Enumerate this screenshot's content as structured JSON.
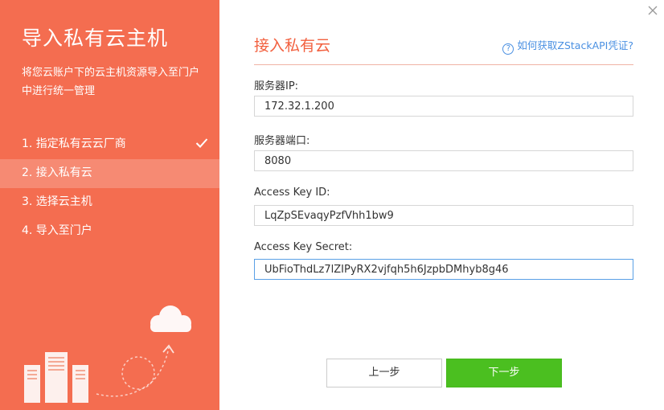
{
  "sidebar": {
    "title": "导入私有云主机",
    "description": "将您云账户下的云主机资源导入至门户中进行统一管理",
    "steps": [
      {
        "label": "1. 指定私有云云厂商",
        "completed": true
      },
      {
        "label": "2. 接入私有云",
        "active": true
      },
      {
        "label": "3. 选择云主机"
      },
      {
        "label": "4. 导入至门户"
      }
    ]
  },
  "panel": {
    "title": "接入私有云",
    "help_link": "如何获取ZStackAPI凭证?"
  },
  "form": {
    "server_ip": {
      "label": "服务器IP:",
      "value": "172.32.1.200"
    },
    "server_port": {
      "label": "服务器端口:",
      "value": "8080"
    },
    "access_key_id": {
      "label": "Access Key ID:",
      "value": "LqZpSEvaqyPzfVhh1bw9"
    },
    "access_key_secret": {
      "label": "Access Key Secret:",
      "value": "UbFioThdLz7lZIPyRX2vjfqh5h6JzpbDMhyb8g46"
    }
  },
  "buttons": {
    "prev": "上一步",
    "next": "下一步"
  },
  "colors": {
    "sidebar_bg": "#f46d50",
    "accent": "#f2603f",
    "primary_button": "#4bbf20",
    "link": "#4a90e2"
  }
}
